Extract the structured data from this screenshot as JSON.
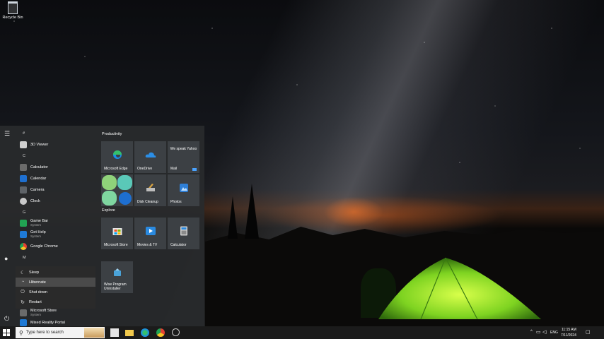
{
  "desktop": {
    "icons": [
      {
        "label": "Recycle Bin",
        "icon": "recycle-bin-icon"
      }
    ]
  },
  "start_menu": {
    "rail": [
      {
        "icon": "hamburger-menu-icon",
        "glyph": "☰"
      },
      {
        "icon": "user-avatar-icon",
        "glyph": "●"
      },
      {
        "icon": "power-icon",
        "glyph": "⏻"
      }
    ],
    "app_list": {
      "letters": [
        "#",
        "C",
        "G",
        "M"
      ],
      "apps": [
        {
          "name": "3D Viewer",
          "sub": "",
          "color": "#cfcfcf"
        },
        {
          "name": "Calculator",
          "sub": "",
          "color": "#6b6b6b"
        },
        {
          "name": "Calendar",
          "sub": "",
          "color": "#1e6fd0"
        },
        {
          "name": "Camera",
          "sub": "",
          "color": "#5f6368"
        },
        {
          "name": "Clock",
          "sub": "",
          "color": "#c9c9c9"
        },
        {
          "name": "Game Bar",
          "sub": "System",
          "color": "#21a453"
        },
        {
          "name": "Get Help",
          "sub": "System",
          "color": "#1e7ad6"
        },
        {
          "name": "Google Chrome",
          "sub": "",
          "color": "#e34133"
        },
        {
          "name": "Microsoft Store",
          "sub": "System",
          "color": "#6b6b6b"
        },
        {
          "name": "Mixed Reality Portal",
          "sub": "",
          "color": "#1e7ad6"
        }
      ]
    },
    "power_menu": [
      {
        "label": "Sleep",
        "icon": "sleep-icon",
        "glyph": "☾"
      },
      {
        "label": "Hibernate",
        "icon": "hibernate-icon",
        "glyph": "◔"
      },
      {
        "label": "Shut down",
        "icon": "shut-down-icon",
        "glyph": "⏻"
      },
      {
        "label": "Restart",
        "icon": "restart-icon",
        "glyph": "↻"
      }
    ],
    "groups": [
      {
        "title": "Productivity"
      },
      {
        "title": "Explore"
      }
    ],
    "tiles": [
      {
        "label": "Microsoft Edge",
        "icon": "edge-icon"
      },
      {
        "label": "OneDrive",
        "icon": "onedrive-icon"
      },
      {
        "label": "Mail",
        "icon": "mail-icon",
        "extra": "We speak Yahoo"
      },
      {
        "label": "",
        "icon": "office-icon"
      },
      {
        "label": "Disk Cleanup",
        "icon": "disk-cleanup-icon"
      },
      {
        "label": "Photos",
        "icon": "photos-icon"
      },
      {
        "label": "Microsoft Store",
        "icon": "store-icon"
      },
      {
        "label": "Movies & TV",
        "icon": "movies-tv-icon"
      },
      {
        "label": "Calculator",
        "icon": "calculator-icon"
      },
      {
        "label": "Wise Program Uninstaller",
        "icon": "wise-uninstaller-icon"
      }
    ]
  },
  "taskbar": {
    "search_placeholder": "Type here to search",
    "apps": [
      {
        "icon": "microsoft-store-icon"
      },
      {
        "icon": "file-explorer-icon"
      },
      {
        "icon": "edge-icon"
      },
      {
        "icon": "chrome-icon"
      },
      {
        "icon": "app-icon"
      }
    ],
    "tray": {
      "language": "ENG",
      "time": "11:15 AM",
      "date": "7/11/2024"
    }
  }
}
